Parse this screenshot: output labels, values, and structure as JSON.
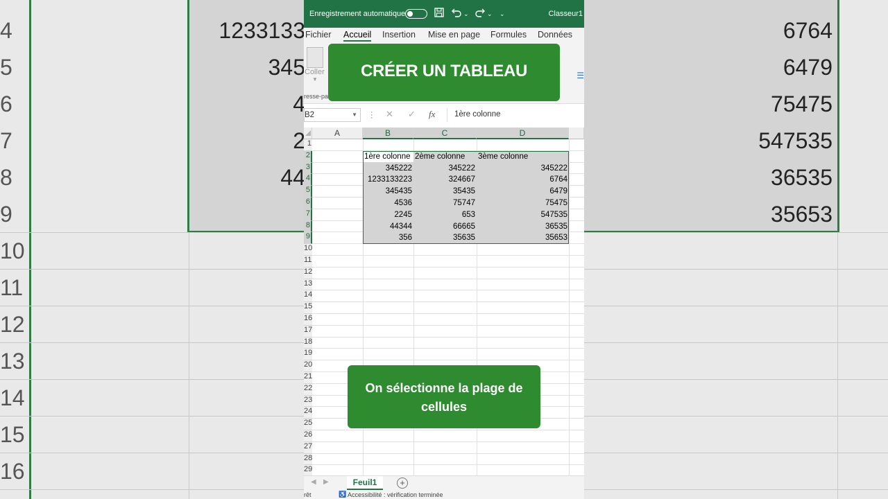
{
  "background": {
    "row_numbers": [
      "4",
      "5",
      "6",
      "7",
      "8",
      "9",
      "10",
      "11",
      "12",
      "13",
      "14",
      "15",
      "16"
    ],
    "left_values": [
      "1233133",
      "345",
      "4",
      "2",
      "44"
    ],
    "right_values": [
      "6764",
      "6479",
      "75475",
      "547535",
      "36535",
      "35653"
    ]
  },
  "titlebar": {
    "autosave_label": "Enregistrement automatique",
    "document_name": "Classeur1"
  },
  "ribbon_tabs": [
    "Fichier",
    "Accueil",
    "Insertion",
    "Mise en page",
    "Formules",
    "Données"
  ],
  "active_tab": "Accueil",
  "ribbon": {
    "paste_label": "Coller",
    "clipboard_group": "resse-pa"
  },
  "formula_bar": {
    "name_box": "B2",
    "fx_label": "fx",
    "value": "1ère colonne"
  },
  "grid": {
    "columns": [
      "A",
      "B",
      "C",
      "D"
    ],
    "rows": [
      "1",
      "2",
      "3",
      "4",
      "5",
      "6",
      "7",
      "8",
      "9",
      "10",
      "11",
      "12",
      "13",
      "14",
      "15",
      "16",
      "17",
      "18",
      "19",
      "20",
      "21",
      "22",
      "23",
      "24",
      "25",
      "26",
      "27",
      "28",
      "29"
    ],
    "headers": [
      "1ère colonne",
      "2ème colonne",
      "3ème colonne"
    ],
    "data": [
      [
        "345222",
        "345222",
        "345222"
      ],
      [
        "1233133223",
        "324667",
        "6764"
      ],
      [
        "345435",
        "35435",
        "6479"
      ],
      [
        "4536",
        "75747",
        "75475"
      ],
      [
        "2245",
        "653",
        "547535"
      ],
      [
        "44344",
        "66665",
        "36535"
      ],
      [
        "356",
        "35635",
        "35653"
      ]
    ]
  },
  "sheet": {
    "tab_name": "Feuil1",
    "add_symbol": "+"
  },
  "status": {
    "ready": "rêt",
    "accessibility": "Accessibilité : vérification terminée"
  },
  "overlay": {
    "title": "CRÉER UN TABLEAU",
    "caption": "On sélectionne la plage de cellules"
  },
  "colors": {
    "excel_green": "#217346",
    "banner_green": "#2e8b30",
    "selection_gray": "#d4d4d4"
  }
}
